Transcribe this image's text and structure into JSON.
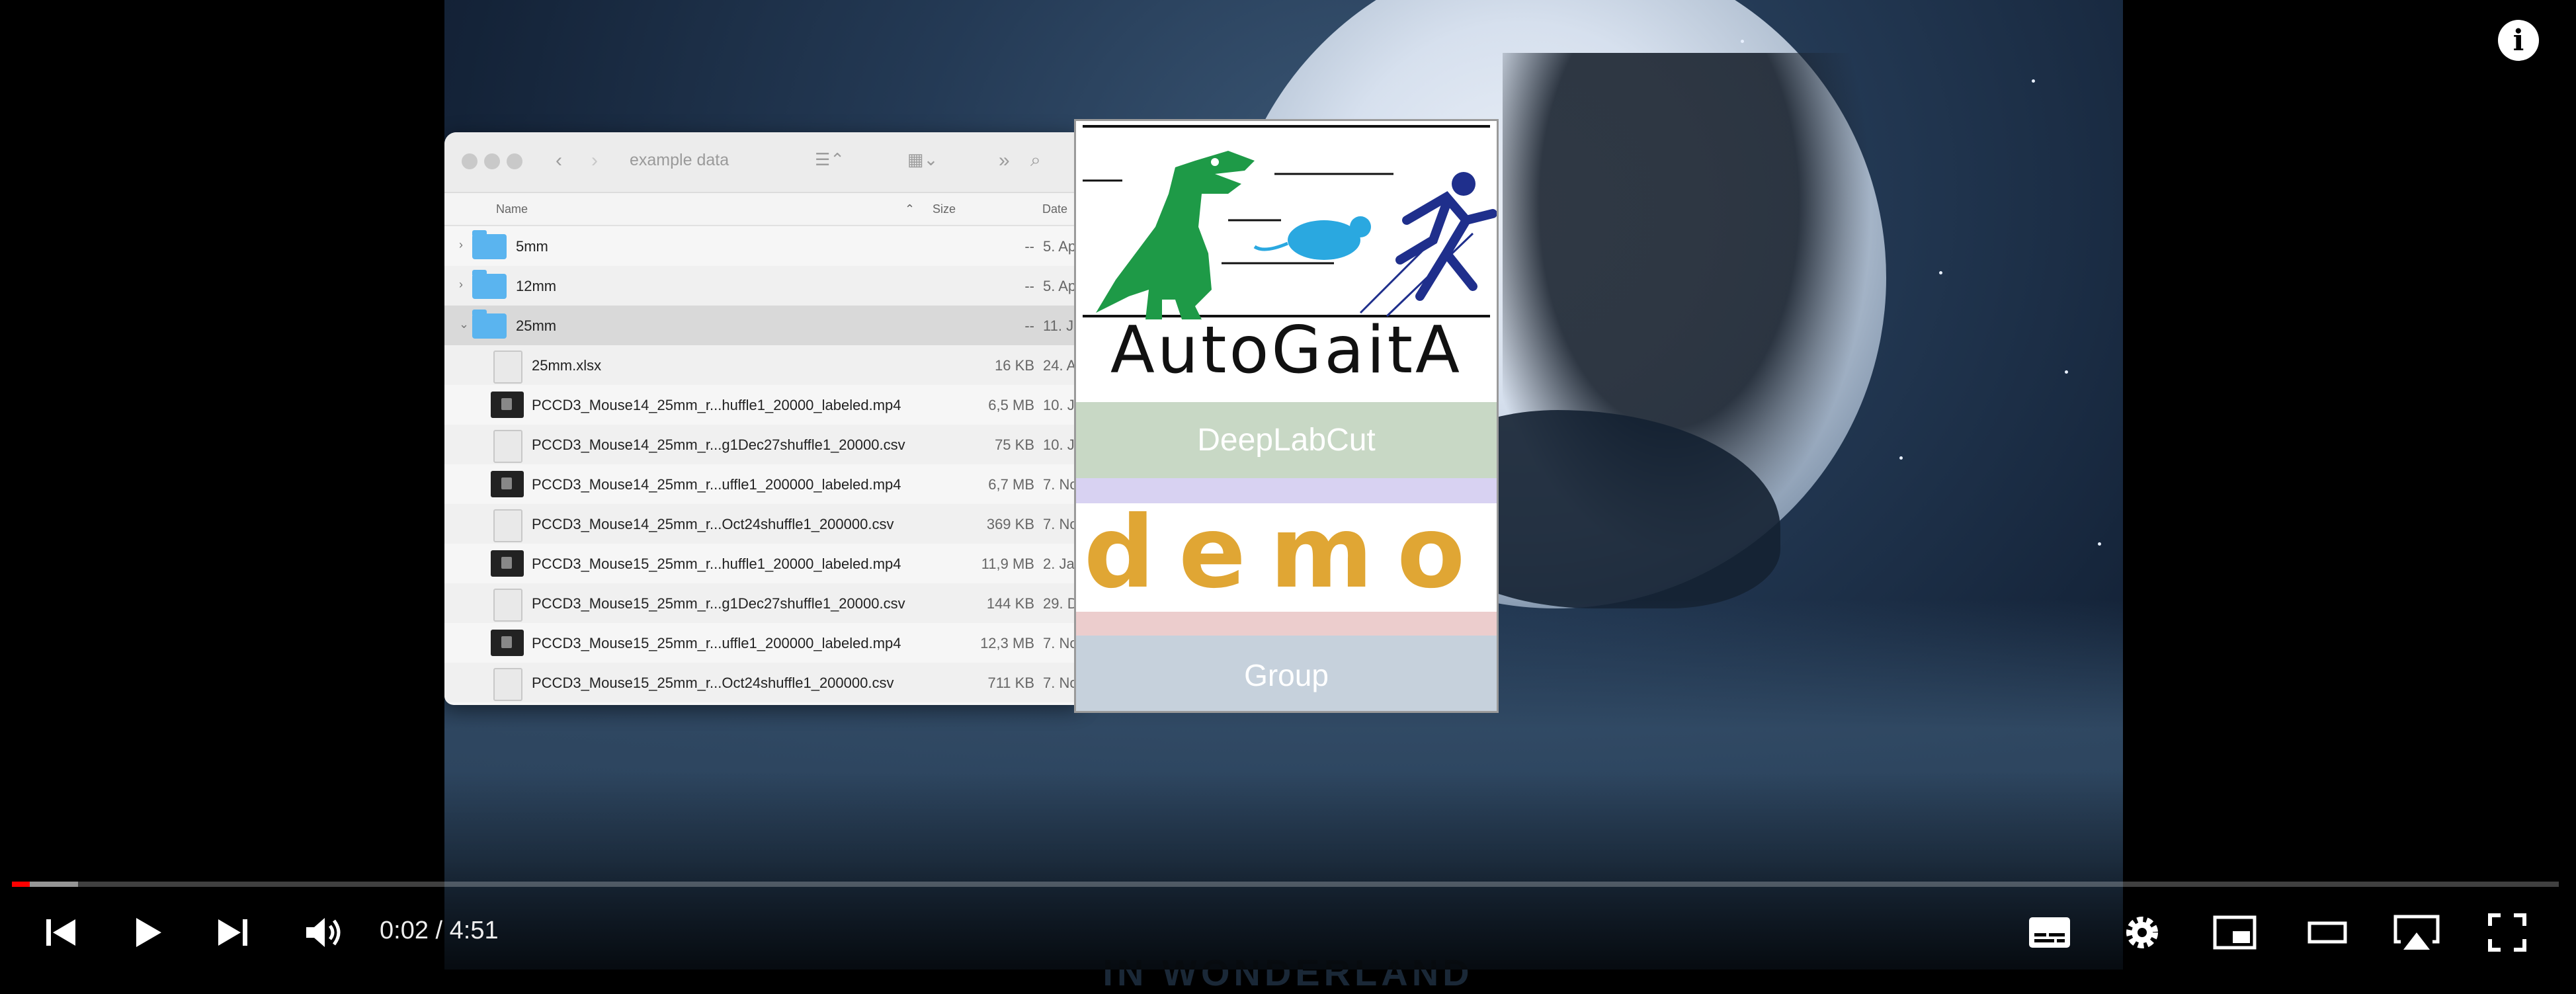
{
  "player": {
    "current_time": "0:02",
    "separator": " / ",
    "duration": "4:51",
    "progress_fraction": 0.0069,
    "buffered_fraction": 0.026,
    "info_icon": "i",
    "overlay_text": "IN WONDERLAND"
  },
  "finder": {
    "title": "example data",
    "columns": {
      "name": "Name",
      "size": "Size",
      "date": "Date"
    },
    "rows": [
      {
        "type": "folder",
        "disclosure": "›",
        "name": "5mm",
        "size": "--",
        "date": "5. Ap"
      },
      {
        "type": "folder",
        "disclosure": "›",
        "name": "12mm",
        "size": "--",
        "date": "5. Ap"
      },
      {
        "type": "folder",
        "disclosure": "⌄",
        "name": "25mm",
        "size": "--",
        "date": "11. J"
      },
      {
        "type": "doc",
        "name": "25mm.xlsx",
        "size": "16 KB",
        "date": "24. A"
      },
      {
        "type": "video",
        "name": "PCCD3_Mouse14_25mm_r...huffle1_20000_labeled.mp4",
        "size": "6,5 MB",
        "date": "10. J"
      },
      {
        "type": "doc",
        "name": "PCCD3_Mouse14_25mm_r...g1Dec27shuffle1_20000.csv",
        "size": "75 KB",
        "date": "10. J"
      },
      {
        "type": "video",
        "name": "PCCD3_Mouse14_25mm_r...uffle1_200000_labeled.mp4",
        "size": "6,7 MB",
        "date": "7. No"
      },
      {
        "type": "doc",
        "name": "PCCD3_Mouse14_25mm_r...Oct24shuffle1_200000.csv",
        "size": "369 KB",
        "date": "7. No"
      },
      {
        "type": "video",
        "name": "PCCD3_Mouse15_25mm_r...huffle1_20000_labeled.mp4",
        "size": "11,9 MB",
        "date": "2. Ja"
      },
      {
        "type": "doc",
        "name": "PCCD3_Mouse15_25mm_r...g1Dec27shuffle1_20000.csv",
        "size": "144 KB",
        "date": "29. D"
      },
      {
        "type": "video",
        "name": "PCCD3_Mouse15_25mm_r...uffle1_200000_labeled.mp4",
        "size": "12,3 MB",
        "date": "7. No"
      },
      {
        "type": "doc",
        "name": "PCCD3_Mouse15_25mm_r...Oct24shuffle1_200000.csv",
        "size": "711 KB",
        "date": "7. No"
      }
    ]
  },
  "card": {
    "brand": "AutoGaitA",
    "band1": "DeepLabCut",
    "demo": "demo",
    "band2": "Group"
  },
  "colors": {
    "progress_played": "#ff0000",
    "demo_text": "#e0a634",
    "crocodile": "#1e9a47",
    "mouse": "#2aa8e0",
    "runner": "#1f2f8c"
  }
}
